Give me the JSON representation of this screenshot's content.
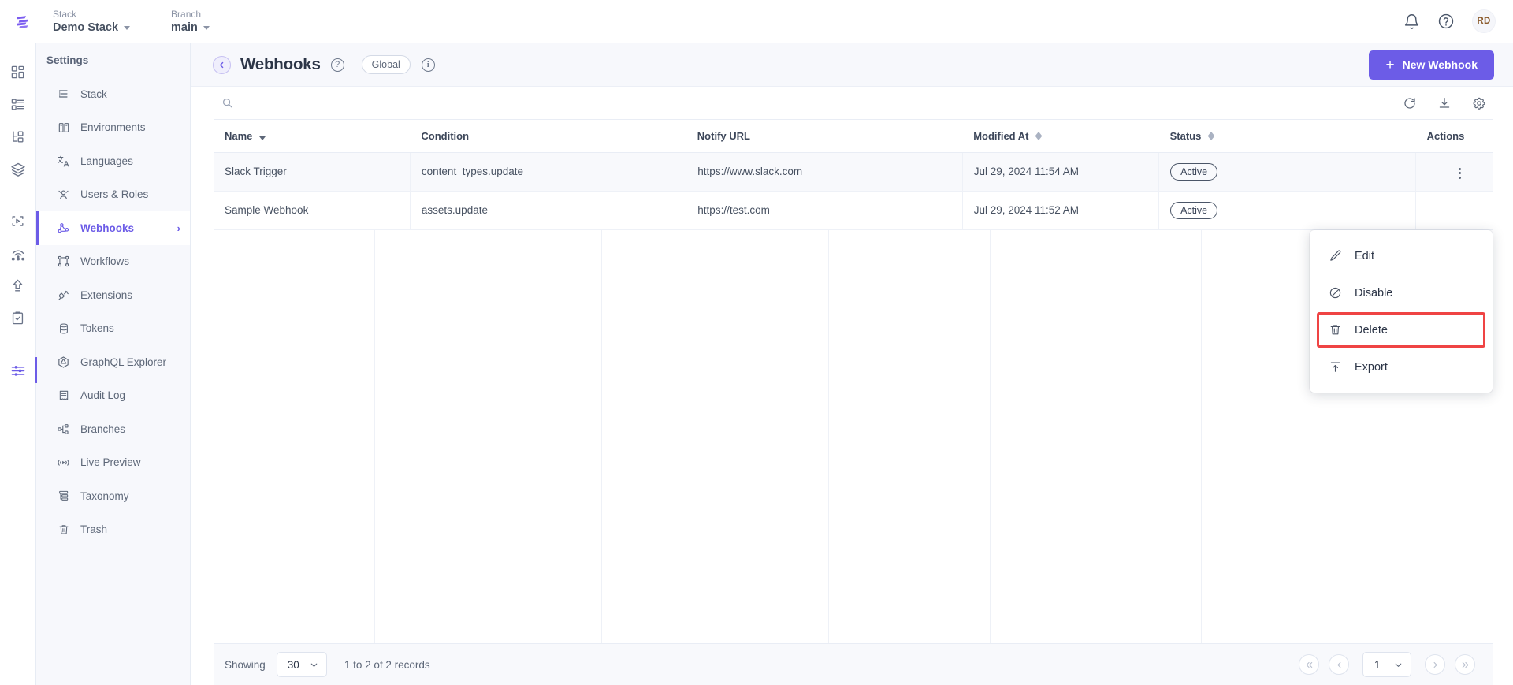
{
  "topbar": {
    "logo": "contentstack-logo",
    "stack": {
      "label": "Stack",
      "value": "Demo Stack"
    },
    "branch": {
      "label": "Branch",
      "value": "main"
    },
    "notifications_icon": "bell-icon",
    "help_icon": "question-circle-icon",
    "avatar_initials": "RD"
  },
  "rail": {
    "items": [
      {
        "name": "dashboard",
        "icon": "dashboard-grid-icon",
        "active": false
      },
      {
        "name": "content-types",
        "icon": "list-blocks-icon",
        "active": false
      },
      {
        "name": "entries",
        "icon": "hierarchy-icon",
        "active": false
      },
      {
        "name": "assets",
        "icon": "layers-icon",
        "active": false
      },
      {
        "name": "live-preview",
        "icon": "play-frame-icon",
        "active": false
      },
      {
        "name": "releases",
        "icon": "broadcast-icon",
        "active": false
      },
      {
        "name": "publish-queue",
        "icon": "upload-arrow-icon",
        "active": false
      },
      {
        "name": "tasks",
        "icon": "clipboard-check-icon",
        "active": false
      },
      {
        "name": "settings",
        "icon": "sliders-icon",
        "active": true
      }
    ]
  },
  "sidebar": {
    "title": "Settings",
    "items": [
      {
        "label": "Stack",
        "icon": "stack-icon",
        "active": false
      },
      {
        "label": "Environments",
        "icon": "environments-icon",
        "active": false
      },
      {
        "label": "Languages",
        "icon": "languages-icon",
        "active": false
      },
      {
        "label": "Users & Roles",
        "icon": "users-roles-icon",
        "active": false
      },
      {
        "label": "Webhooks",
        "icon": "webhooks-icon",
        "active": true
      },
      {
        "label": "Workflows",
        "icon": "workflows-icon",
        "active": false
      },
      {
        "label": "Extensions",
        "icon": "extensions-plug-icon",
        "active": false
      },
      {
        "label": "Tokens",
        "icon": "tokens-database-icon",
        "active": false
      },
      {
        "label": "GraphQL Explorer",
        "icon": "graphql-icon",
        "active": false
      },
      {
        "label": "Audit Log",
        "icon": "audit-log-icon",
        "active": false
      },
      {
        "label": "Branches",
        "icon": "branches-icon",
        "active": false
      },
      {
        "label": "Live Preview",
        "icon": "live-preview-icon",
        "active": false
      },
      {
        "label": "Taxonomy",
        "icon": "taxonomy-icon",
        "active": false
      },
      {
        "label": "Trash",
        "icon": "trash-icon",
        "active": false
      }
    ]
  },
  "page": {
    "back_icon": "chevron-left-icon",
    "title": "Webhooks",
    "help_icon": "question-circle-icon",
    "scope_pill": "Global",
    "info_icon": "info-circle-icon",
    "primary_button": {
      "label": "New Webhook",
      "icon": "plus-icon"
    }
  },
  "toolbar": {
    "search_icon": "search-icon",
    "search_placeholder": "",
    "search_value": "",
    "refresh_icon": "refresh-icon",
    "download_icon": "download-icon",
    "settings_icon": "gear-icon"
  },
  "table": {
    "columns": [
      {
        "label": "Name",
        "sortable": true,
        "sort": "desc"
      },
      {
        "label": "Condition",
        "sortable": false,
        "sort": "none"
      },
      {
        "label": "Notify URL",
        "sortable": false,
        "sort": "none"
      },
      {
        "label": "Modified At",
        "sortable": true,
        "sort": "none"
      },
      {
        "label": "Status",
        "sortable": true,
        "sort": "none"
      },
      {
        "label": "Actions",
        "sortable": false,
        "sort": "none"
      }
    ],
    "rows": [
      {
        "name": "Slack Trigger",
        "condition": "content_types.update",
        "notify_url": "https://www.slack.com",
        "modified_at": "Jul 29, 2024 11:54 AM",
        "status": "Active",
        "actions_icon": "kebab-menu-icon"
      },
      {
        "name": "Sample Webhook",
        "condition": "assets.update",
        "notify_url": "https://test.com",
        "modified_at": "Jul 29, 2024 11:52 AM",
        "status": "Active",
        "actions_icon": "kebab-menu-icon"
      }
    ]
  },
  "context_menu": {
    "items": [
      {
        "label": "Edit",
        "icon": "pencil-icon",
        "highlighted": false
      },
      {
        "label": "Disable",
        "icon": "ban-circle-icon",
        "highlighted": false
      },
      {
        "label": "Delete",
        "icon": "trash-icon",
        "highlighted": true
      },
      {
        "label": "Export",
        "icon": "export-upload-icon",
        "highlighted": false
      }
    ],
    "highlight_color": "#ef4444"
  },
  "footer": {
    "showing_label": "Showing",
    "page_size": "30",
    "records_label": "1 to 2 of 2 records",
    "first_icon": "double-chevron-left-icon",
    "prev_icon": "chevron-left-icon",
    "current_page": "1",
    "next_icon": "chevron-right-icon",
    "last_icon": "double-chevron-right-icon"
  },
  "colors": {
    "accent": "#6c5ce7",
    "danger": "#ef4444",
    "text": "#475161",
    "sidebar_bg": "#f7f8fc"
  }
}
